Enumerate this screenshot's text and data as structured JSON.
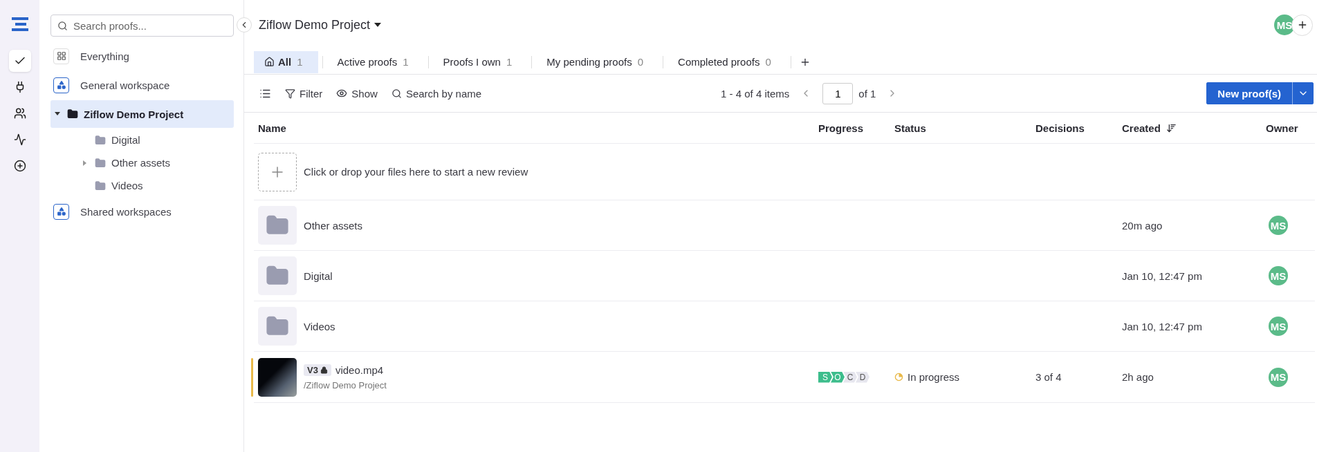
{
  "rail": [
    {
      "selected": true
    },
    {
      "selected": false
    },
    {
      "selected": false
    },
    {
      "selected": false
    },
    {
      "selected": false
    }
  ],
  "sidebar": {
    "search": {
      "placeholder": "Search proofs..."
    },
    "items": [
      {
        "kind": "everything",
        "label": "Everything",
        "selected": false
      },
      {
        "kind": "workspace",
        "label": "General workspace",
        "selected": false,
        "children": [
          {
            "kind": "folder",
            "label": "Ziflow Demo Project",
            "selected": true,
            "expanded": true,
            "children": [
              {
                "kind": "folder",
                "label": "Digital",
                "selected": false
              },
              {
                "kind": "folder",
                "label": "Other assets",
                "selected": false,
                "expanded": false
              },
              {
                "kind": "folder",
                "label": "Videos",
                "selected": false
              }
            ]
          }
        ]
      },
      {
        "kind": "workspace",
        "label": "Shared workspaces",
        "selected": false
      }
    ]
  },
  "header": {
    "title": "Ziflow Demo Project",
    "avatar": "MS"
  },
  "tabs": [
    {
      "label": "All",
      "count": "1",
      "selected": true
    },
    {
      "label": "Active proofs",
      "count": "1",
      "selected": false
    },
    {
      "label": "Proofs I own",
      "count": "1",
      "selected": false
    },
    {
      "label": "My pending proofs",
      "count": "0",
      "selected": false
    },
    {
      "label": "Completed proofs",
      "count": "0",
      "selected": false
    }
  ],
  "toolbar": {
    "filter": "Filter",
    "show": "Show",
    "search": "Search by name",
    "range": "1 - 4 of 4 items",
    "page": "1",
    "of": "of 1",
    "new_button": "New proof(s)"
  },
  "table": {
    "columns": [
      "Name",
      "Progress",
      "Status",
      "Decisions",
      "Created",
      "Owner"
    ],
    "upload_text": "Click or drop your files here to start a new review",
    "rows": [
      {
        "kind": "folder",
        "name": "Other assets",
        "created": "20m ago",
        "owner": "MS"
      },
      {
        "kind": "folder",
        "name": "Digital",
        "created": "Jan 10, 12:47 pm",
        "owner": "MS"
      },
      {
        "kind": "folder",
        "name": "Videos",
        "created": "Jan 10, 12:47 pm",
        "owner": "MS"
      },
      {
        "kind": "proof",
        "name": "video.mp4",
        "version": "V3",
        "locked": true,
        "path": "/Ziflow Demo Project",
        "stages": [
          {
            "letter": "S",
            "done": true
          },
          {
            "letter": "O",
            "done": true
          },
          {
            "letter": "C",
            "done": false
          },
          {
            "letter": "D",
            "done": false
          }
        ],
        "status": "In progress",
        "decisions": "3 of 4",
        "created": "2h ago",
        "owner": "MS"
      }
    ]
  }
}
